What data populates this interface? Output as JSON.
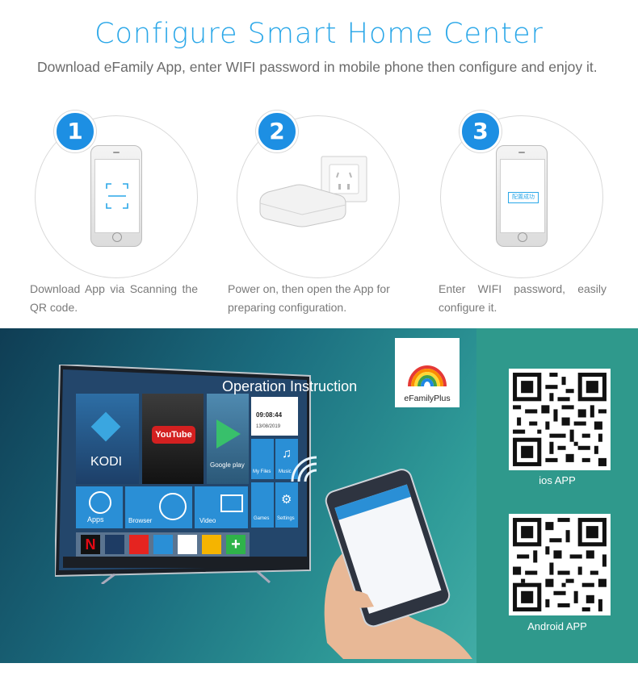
{
  "header": {
    "title": "Configure Smart Home Center",
    "subtitle": "Download eFamily App, enter WIFI password in mobile phone then configure and enjoy it."
  },
  "steps": [
    {
      "number": "1",
      "text": "Download App via Scanning the QR code."
    },
    {
      "number": "2",
      "text": "Power on, then open the App for preparing configuration."
    },
    {
      "number": "3",
      "text": "Enter WIFI password, easily configure it.",
      "screen_text": "配置成功"
    }
  ],
  "promo": {
    "operation_title": "Operation Instruction",
    "brand": "eFamilyPlus",
    "ios_label": "ios APP",
    "android_label": "Android APP"
  },
  "tv": {
    "kodi": "KODI",
    "youtube": "YouTube",
    "google_play": "Google play",
    "time": "09:08:44",
    "date": "13/08/2019",
    "my_files": "My Files",
    "music": "Music",
    "apps": "Apps",
    "browser": "Browser",
    "video": "Video",
    "games": "Games",
    "settings": "Settings"
  },
  "colors": {
    "title": "#2aa7e8",
    "badge": "#1d8fe3",
    "sidebar": "#2f998c"
  }
}
